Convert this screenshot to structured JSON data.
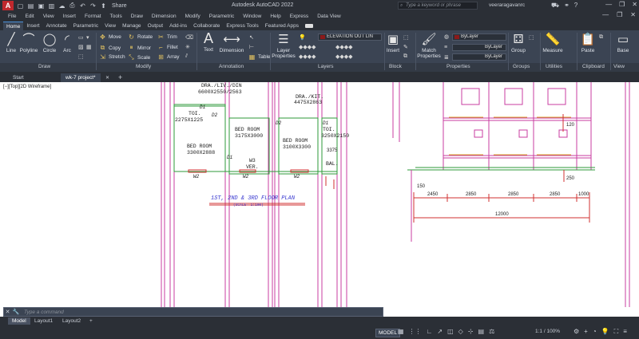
{
  "titlebar": {
    "logo": "A",
    "share_label": "Share",
    "app_title": "Autodesk AutoCAD 2022",
    "search_placeholder": "Type a keyword or phrase",
    "user": "veeraragavanrc"
  },
  "menu": [
    "File",
    "Edit",
    "View",
    "Insert",
    "Format",
    "Tools",
    "Draw",
    "Dimension",
    "Modify",
    "Parametric",
    "Window",
    "Help",
    "Express",
    "Data View"
  ],
  "ribbon_tabs": [
    "Home",
    "Insert",
    "Annotate",
    "Parametric",
    "View",
    "Manage",
    "Output",
    "Add-ins",
    "Collaborate",
    "Express Tools",
    "Featured Apps"
  ],
  "ribbon_active_tab": "Home",
  "draw_panel": {
    "title": "Draw",
    "line": "Line",
    "polyline": "Polyline",
    "circle": "Circle",
    "arc": "Arc"
  },
  "modify_panel": {
    "title": "Modify",
    "move": "Move",
    "rotate": "Rotate",
    "trim": "Trim",
    "copy": "Copy",
    "mirror": "Mirror",
    "fillet": "Fillet",
    "stretch": "Stretch",
    "scale": "Scale",
    "array": "Array"
  },
  "annotation_panel": {
    "title": "Annotation",
    "text": "Text",
    "dimension": "Dimension",
    "table": "Table"
  },
  "layers_panel": {
    "title": "Layers",
    "layer_properties": "Layer Properties",
    "current_layer": "ELEVATION OUT LIN"
  },
  "block_panel": {
    "title": "Block",
    "insert": "Insert"
  },
  "properties_panel": {
    "title": "Properties",
    "match": "Match Properties",
    "color": "ByLayer",
    "linetype": "ByLayer",
    "lineweight": "ByLayer"
  },
  "groups_panel": {
    "title": "Groups",
    "group": "Group"
  },
  "utilities_panel": {
    "title": "Utilities",
    "measure": "Measure"
  },
  "clipboard_panel": {
    "title": "Clipboard",
    "paste": "Paste"
  },
  "view_panel": {
    "title": "View",
    "base": "Base"
  },
  "doc_tabs": {
    "start": "Start",
    "drawing": "wk-7 project*"
  },
  "viewport_label": "[−][Top][2D Wireframe]",
  "drawing": {
    "rooms": [
      {
        "name": "DRA./LIV./DIN",
        "size": "6600X2550/2563"
      },
      {
        "name": "DRA./KIT.",
        "size": "4475X2863"
      },
      {
        "name": "TOI.",
        "size": "2275X1225"
      },
      {
        "name": "BED ROOM",
        "size": "3175X3000"
      },
      {
        "name": "BED ROOM",
        "size": "3100X3300"
      },
      {
        "name": "BED ROOM",
        "size": "3300X2888"
      },
      {
        "name": "TOI.",
        "size": "3250X2150"
      },
      {
        "name": "W3",
        "size": "VER."
      },
      {
        "name": "BAL.",
        "size": ""
      }
    ],
    "door_tags": [
      "D1",
      "D2",
      "D2",
      "D1",
      "D1"
    ],
    "window_tags": [
      "W2",
      "W2",
      "W2"
    ],
    "plan_title": "1ST, 2ND & 3RD FLOOR PLAN",
    "plan_scale": "(SCALE- 1:100)",
    "dims_right": [
      "2450",
      "2850",
      "2850",
      "2850",
      "1000"
    ],
    "dim_total": "12000",
    "dim_small": [
      "150",
      "120",
      "250",
      "3375"
    ]
  },
  "command": {
    "placeholder": "Type a command"
  },
  "layout_tabs": [
    "Model",
    "Layout1",
    "Layout2"
  ],
  "status": {
    "model": "MODEL",
    "scale": "1:1 / 100%"
  }
}
